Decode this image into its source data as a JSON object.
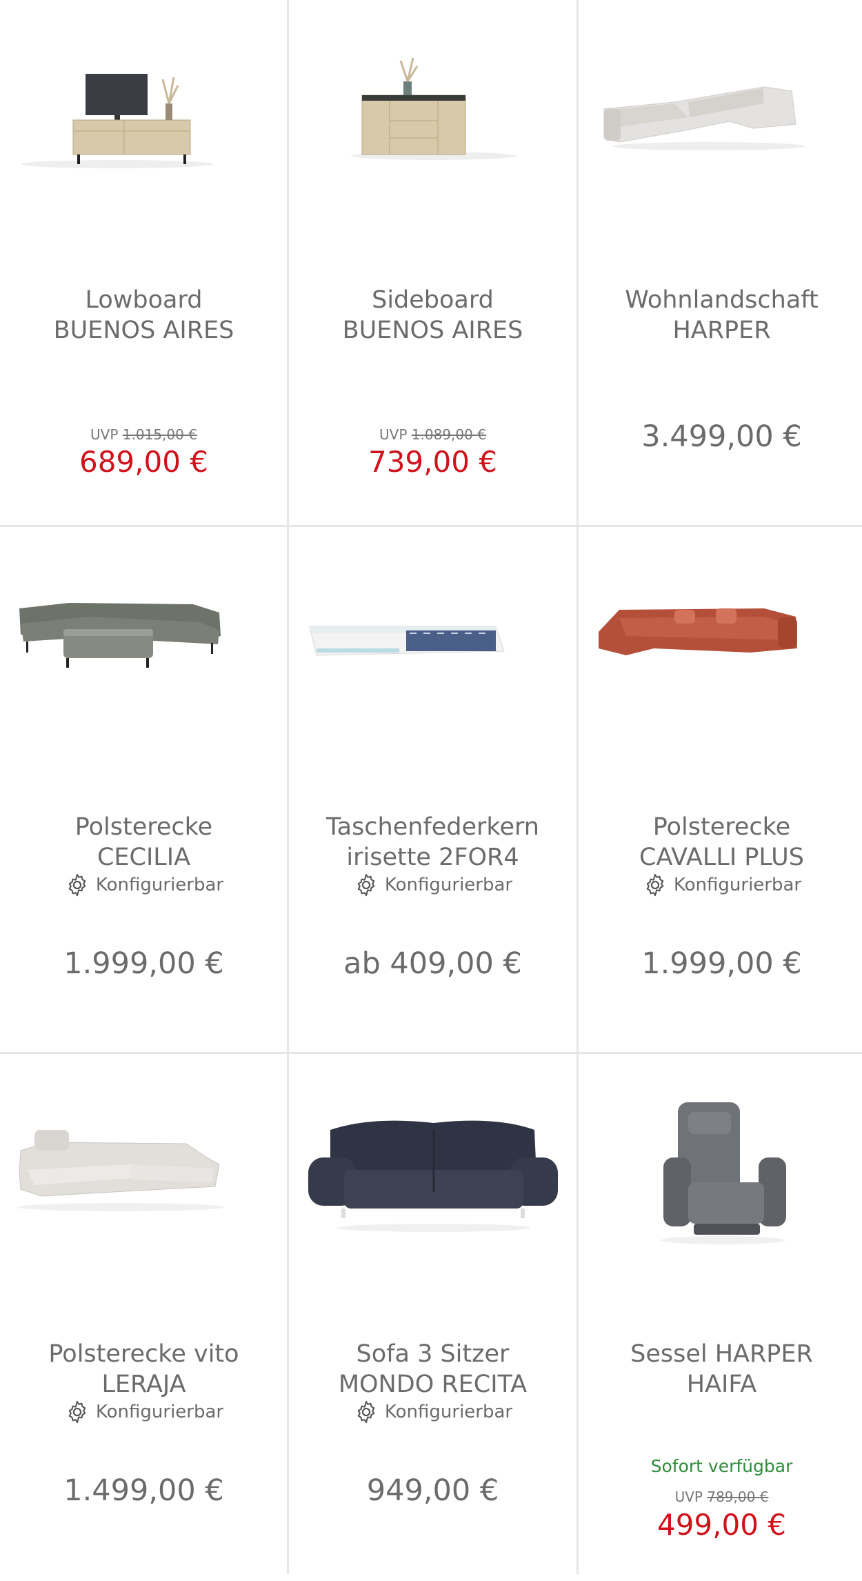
{
  "products": [
    {
      "title_line1": "Lowboard",
      "title_line2": "BUENOS AIRES",
      "uvp_label": "UVP",
      "uvp_price": "1.015,00 €",
      "price": "689,00 €",
      "icon": "lowboard-image"
    },
    {
      "title_line1": "Sideboard",
      "title_line2": "BUENOS AIRES",
      "uvp_label": "UVP",
      "uvp_price": "1.089,00 €",
      "price": "739,00 €",
      "icon": "sideboard-image"
    },
    {
      "title_line1": "Wohnlandschaft",
      "title_line2": "HARPER",
      "price": "3.499,00 €",
      "icon": "sofa-landscape-image"
    },
    {
      "title_line1": "Polsterecke",
      "title_line2": "CECILIA",
      "config_label": "Konfigurierbar",
      "price": "1.999,00 €",
      "icon": "corner-sofa-image"
    },
    {
      "title_line1": "Taschenfederkern",
      "title_line2": "irisette 2FOR4",
      "config_label": "Konfigurierbar",
      "price": "ab 409,00 €",
      "icon": "mattress-image"
    },
    {
      "title_line1": "Polsterecke",
      "title_line2": "CAVALLI PLUS",
      "config_label": "Konfigurierbar",
      "price": "1.999,00 €",
      "icon": "corner-sofa-image"
    },
    {
      "title_line1": "Polsterecke vito",
      "title_line2": "LERAJA",
      "config_label": "Konfigurierbar",
      "price": "1.499,00 €",
      "icon": "corner-sofa-image"
    },
    {
      "title_line1": "Sofa 3 Sitzer",
      "title_line2": "MONDO RECITA",
      "config_label": "Konfigurierbar",
      "price": "949,00 €",
      "icon": "sofa-image"
    },
    {
      "title_line1": "Sessel HARPER",
      "title_line2": "HAIFA",
      "availability": "Sofort verfügbar",
      "uvp_label": "UVP",
      "uvp_price": "789,00 €",
      "price": "499,00 €",
      "icon": "armchair-image"
    }
  ],
  "colors": {
    "sale": "#d0121b",
    "available": "#2e8b3a",
    "text": "#6b6b6b",
    "divider": "#e6e6e6"
  }
}
